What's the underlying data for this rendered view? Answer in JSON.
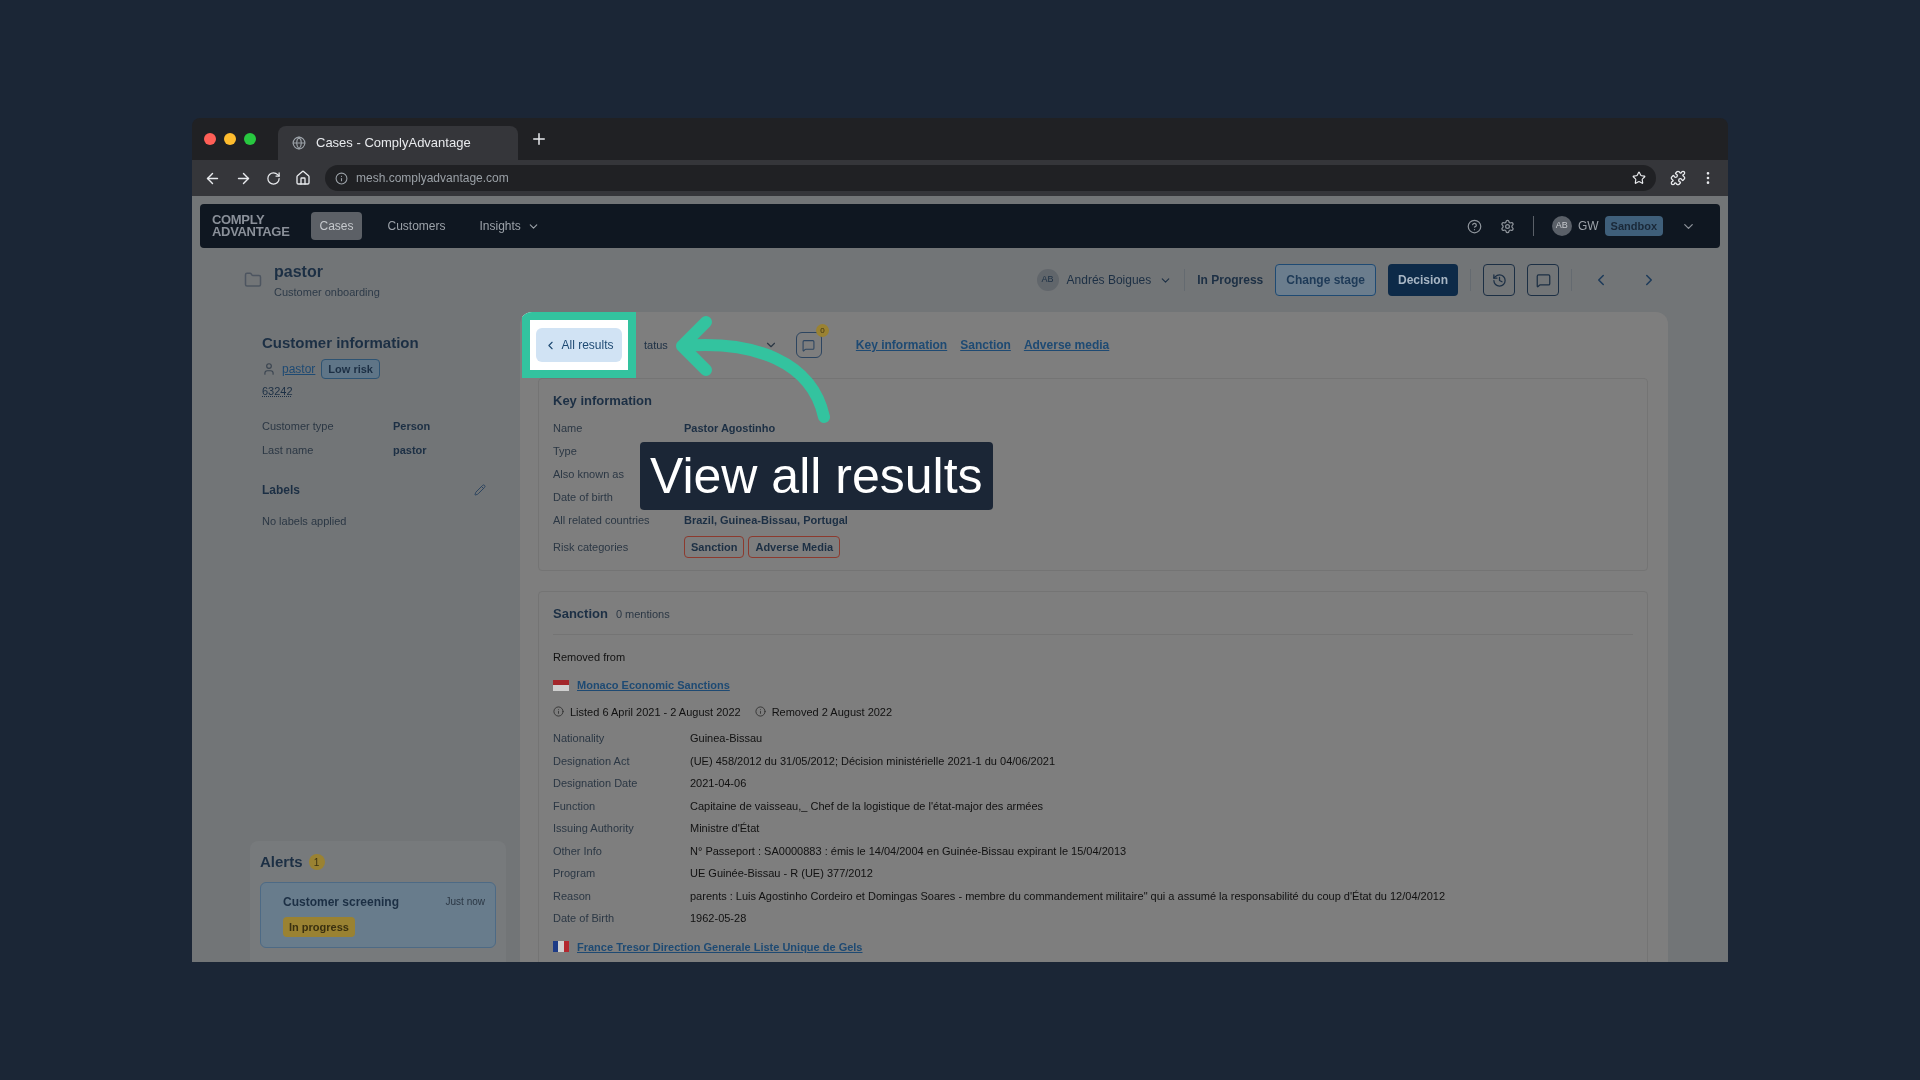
{
  "browser": {
    "tabs": [
      {
        "title": "Cases - ComplyAdvantage",
        "selected": true
      }
    ],
    "url": "mesh.complyadvantage.com"
  },
  "app_nav": {
    "logo": [
      "COMPLY",
      "ADVANTAGE"
    ],
    "items": [
      {
        "label": "Cases",
        "selected": true,
        "dropdown": false
      },
      {
        "label": "Customers",
        "selected": false,
        "dropdown": false
      },
      {
        "label": "Insights",
        "selected": false,
        "dropdown": true
      }
    ],
    "user_initials": "AB",
    "user": "GW",
    "environment": "Sandbox"
  },
  "case_header": {
    "title": "pastor",
    "subtitle": "Customer onboarding",
    "assignee_initials": "AB",
    "assignee": "Andrés Boigues",
    "stage": "In Progress",
    "buttons": [
      {
        "label": "Change stage",
        "kind": "outline"
      },
      {
        "label": "Decision",
        "kind": "primary"
      }
    ]
  },
  "customer": {
    "heading": "Customer information",
    "name": "pastor",
    "risk": "Low risk",
    "id": "63242",
    "fields": [
      {
        "label": "Customer type",
        "value": "Person"
      },
      {
        "label": "Last name",
        "value": "pastor"
      }
    ],
    "labels_heading": "Labels",
    "labels_empty": "No labels applied"
  },
  "alerts": {
    "heading": "Alerts",
    "count": "1",
    "items": [
      {
        "title": "Customer screening",
        "time": "Just now",
        "status": "In progress"
      }
    ]
  },
  "result": {
    "back": "All results",
    "status_label": "tatus",
    "comments_count": "0",
    "links": [
      "Key information",
      "Sanction",
      "Adverse media"
    ]
  },
  "key_information": {
    "heading": "Key information",
    "rows": [
      {
        "label": "Name",
        "value": "Pastor Agostinho"
      },
      {
        "label": "Type"
      },
      {
        "label": "Also known as"
      },
      {
        "label": "Date of birth"
      },
      {
        "label": "All related countries",
        "value": "Brazil, Guinea-Bissau, Portugal"
      }
    ],
    "risk_label": "Risk categories",
    "risk_tags": [
      "Sanction",
      "Adverse Media"
    ]
  },
  "sanction": {
    "heading": "Sanction",
    "mentions": "0 mentions",
    "removed_label": "Removed from",
    "sources": [
      {
        "kind": "monaco",
        "name": "Monaco Economic Sanctions",
        "listed": "Listed 6 April 2021 - 2 August 2022",
        "removed": "Removed 2 August 2022",
        "rows": [
          {
            "label": "Nationality",
            "value": "Guinea-Bissau"
          },
          {
            "label": "Designation Act",
            "value": "(UE) 458/2012 du 31/05/2012; Décision ministérielle 2021-1 du 04/06/2021"
          },
          {
            "label": "Designation Date",
            "value": "2021-04-06"
          },
          {
            "label": "Function",
            "value": "Capitaine de vaisseau,_ Chef de la logistique de l'état-major des armées"
          },
          {
            "label": "Issuing Authority",
            "value": "Ministre d'État"
          },
          {
            "label": "Other Info",
            "value": "N° Passeport : SA0000883 : émis le 14/04/2004 en Guinée-Bissau expirant le 15/04/2013"
          },
          {
            "label": "Program",
            "value": "UE Guinée-Bissau - R (UE) 377/2012"
          },
          {
            "label": "Reason",
            "value": "parents : Luis Agostinho Cordeiro et Domingas Soares - membre du commandement militaire\" qui a assumé la responsabilité du coup d'État du 12/04/2012"
          },
          {
            "label": "Date of Birth",
            "value": "1962-05-28"
          }
        ]
      },
      {
        "kind": "france",
        "name": "France Tresor Direction Generale Liste Unique de Gels"
      }
    ]
  },
  "callout": {
    "text": "View all results"
  }
}
